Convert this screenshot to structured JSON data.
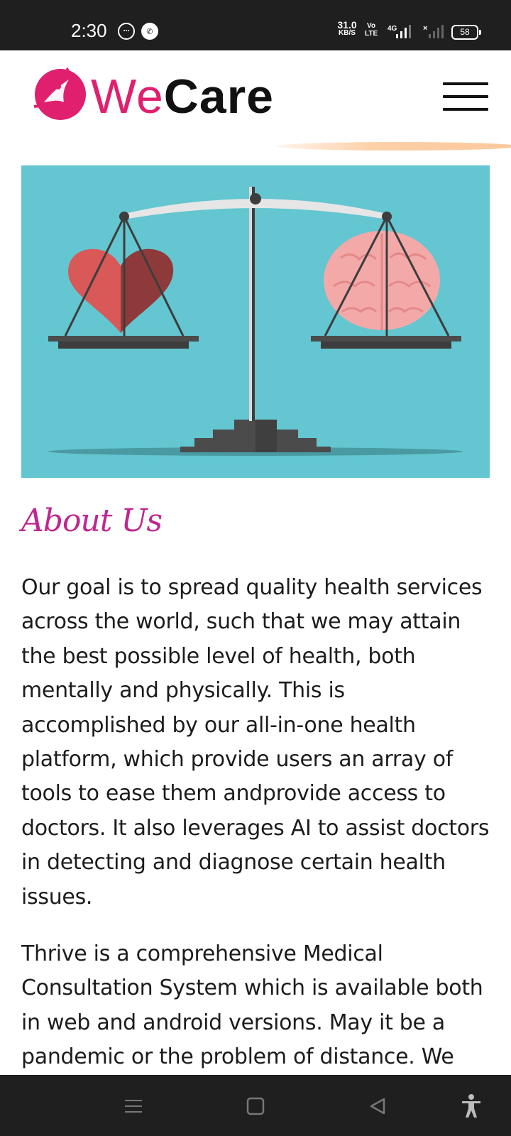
{
  "status_bar": {
    "time": "2:30",
    "net_speed_value": "31.0",
    "net_speed_unit": "KB/S",
    "volte_top": "Vo",
    "volte_bottom": "LTE",
    "network_type": "4G",
    "battery": "58",
    "icons": [
      "messaging-icon",
      "phone-call-icon",
      "signal-icon",
      "battery-icon"
    ]
  },
  "header": {
    "logo_we": "We",
    "logo_care": "Care",
    "brand_color": "#e0206e",
    "menu_icon": "hamburger-menu-icon"
  },
  "hero": {
    "icon": "balance-scale-heart-brain-illustration",
    "background_color": "#63c6d0"
  },
  "about": {
    "title": "About Us",
    "title_color": "#c0268f",
    "paragraph_1": "Our goal is to spread quality health services across the world, such that we may attain the best possible level of health, both mentally and physically. This is accomplished by our all-in-one health platform, which provide users an array of tools to ease them andprovide access to doctors. It also leverages AI to assist doctors in detecting and diagnose certain health issues.",
    "paragraph_2": "Thrive is a comprehensive Medical Consultation System which is available both in web and android versions. May it be a pandemic or the problem of distance. We"
  },
  "nav_bar": {
    "icons": [
      "recent-apps-icon",
      "home-icon",
      "back-icon",
      "accessibility-icon"
    ]
  }
}
